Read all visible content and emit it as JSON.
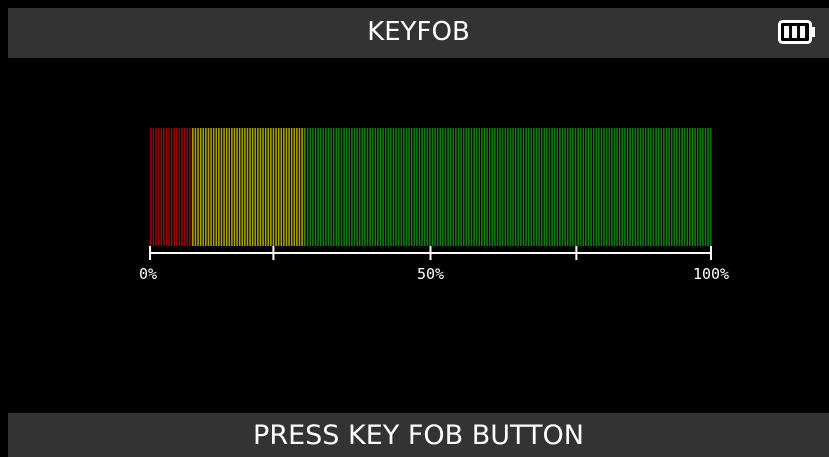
{
  "header": {
    "title": "KEYFOB",
    "battery_icon": "battery-full-icon"
  },
  "gauge": {
    "level_percent": 100,
    "segments": [
      {
        "name": "red",
        "from_percent": 0,
        "to_percent": 7.5,
        "color": "#8b0a0a"
      },
      {
        "name": "yellow",
        "from_percent": 7.5,
        "to_percent": 27.5,
        "color": "#a8a000"
      },
      {
        "name": "green",
        "from_percent": 27.5,
        "to_percent": 100,
        "color": "#0f7a0f"
      }
    ],
    "scale_labels": [
      {
        "percent": 0,
        "text": "0%"
      },
      {
        "percent": 50,
        "text": "50%"
      },
      {
        "percent": 100,
        "text": "100%"
      }
    ],
    "ticks_percent": [
      0,
      22,
      50,
      76,
      100
    ]
  },
  "footer": {
    "prompt": "PRESS KEY FOB BUTTON"
  },
  "colors": {
    "bar_background": "#333333",
    "screen_background": "#000000",
    "text": "#ffffff"
  }
}
